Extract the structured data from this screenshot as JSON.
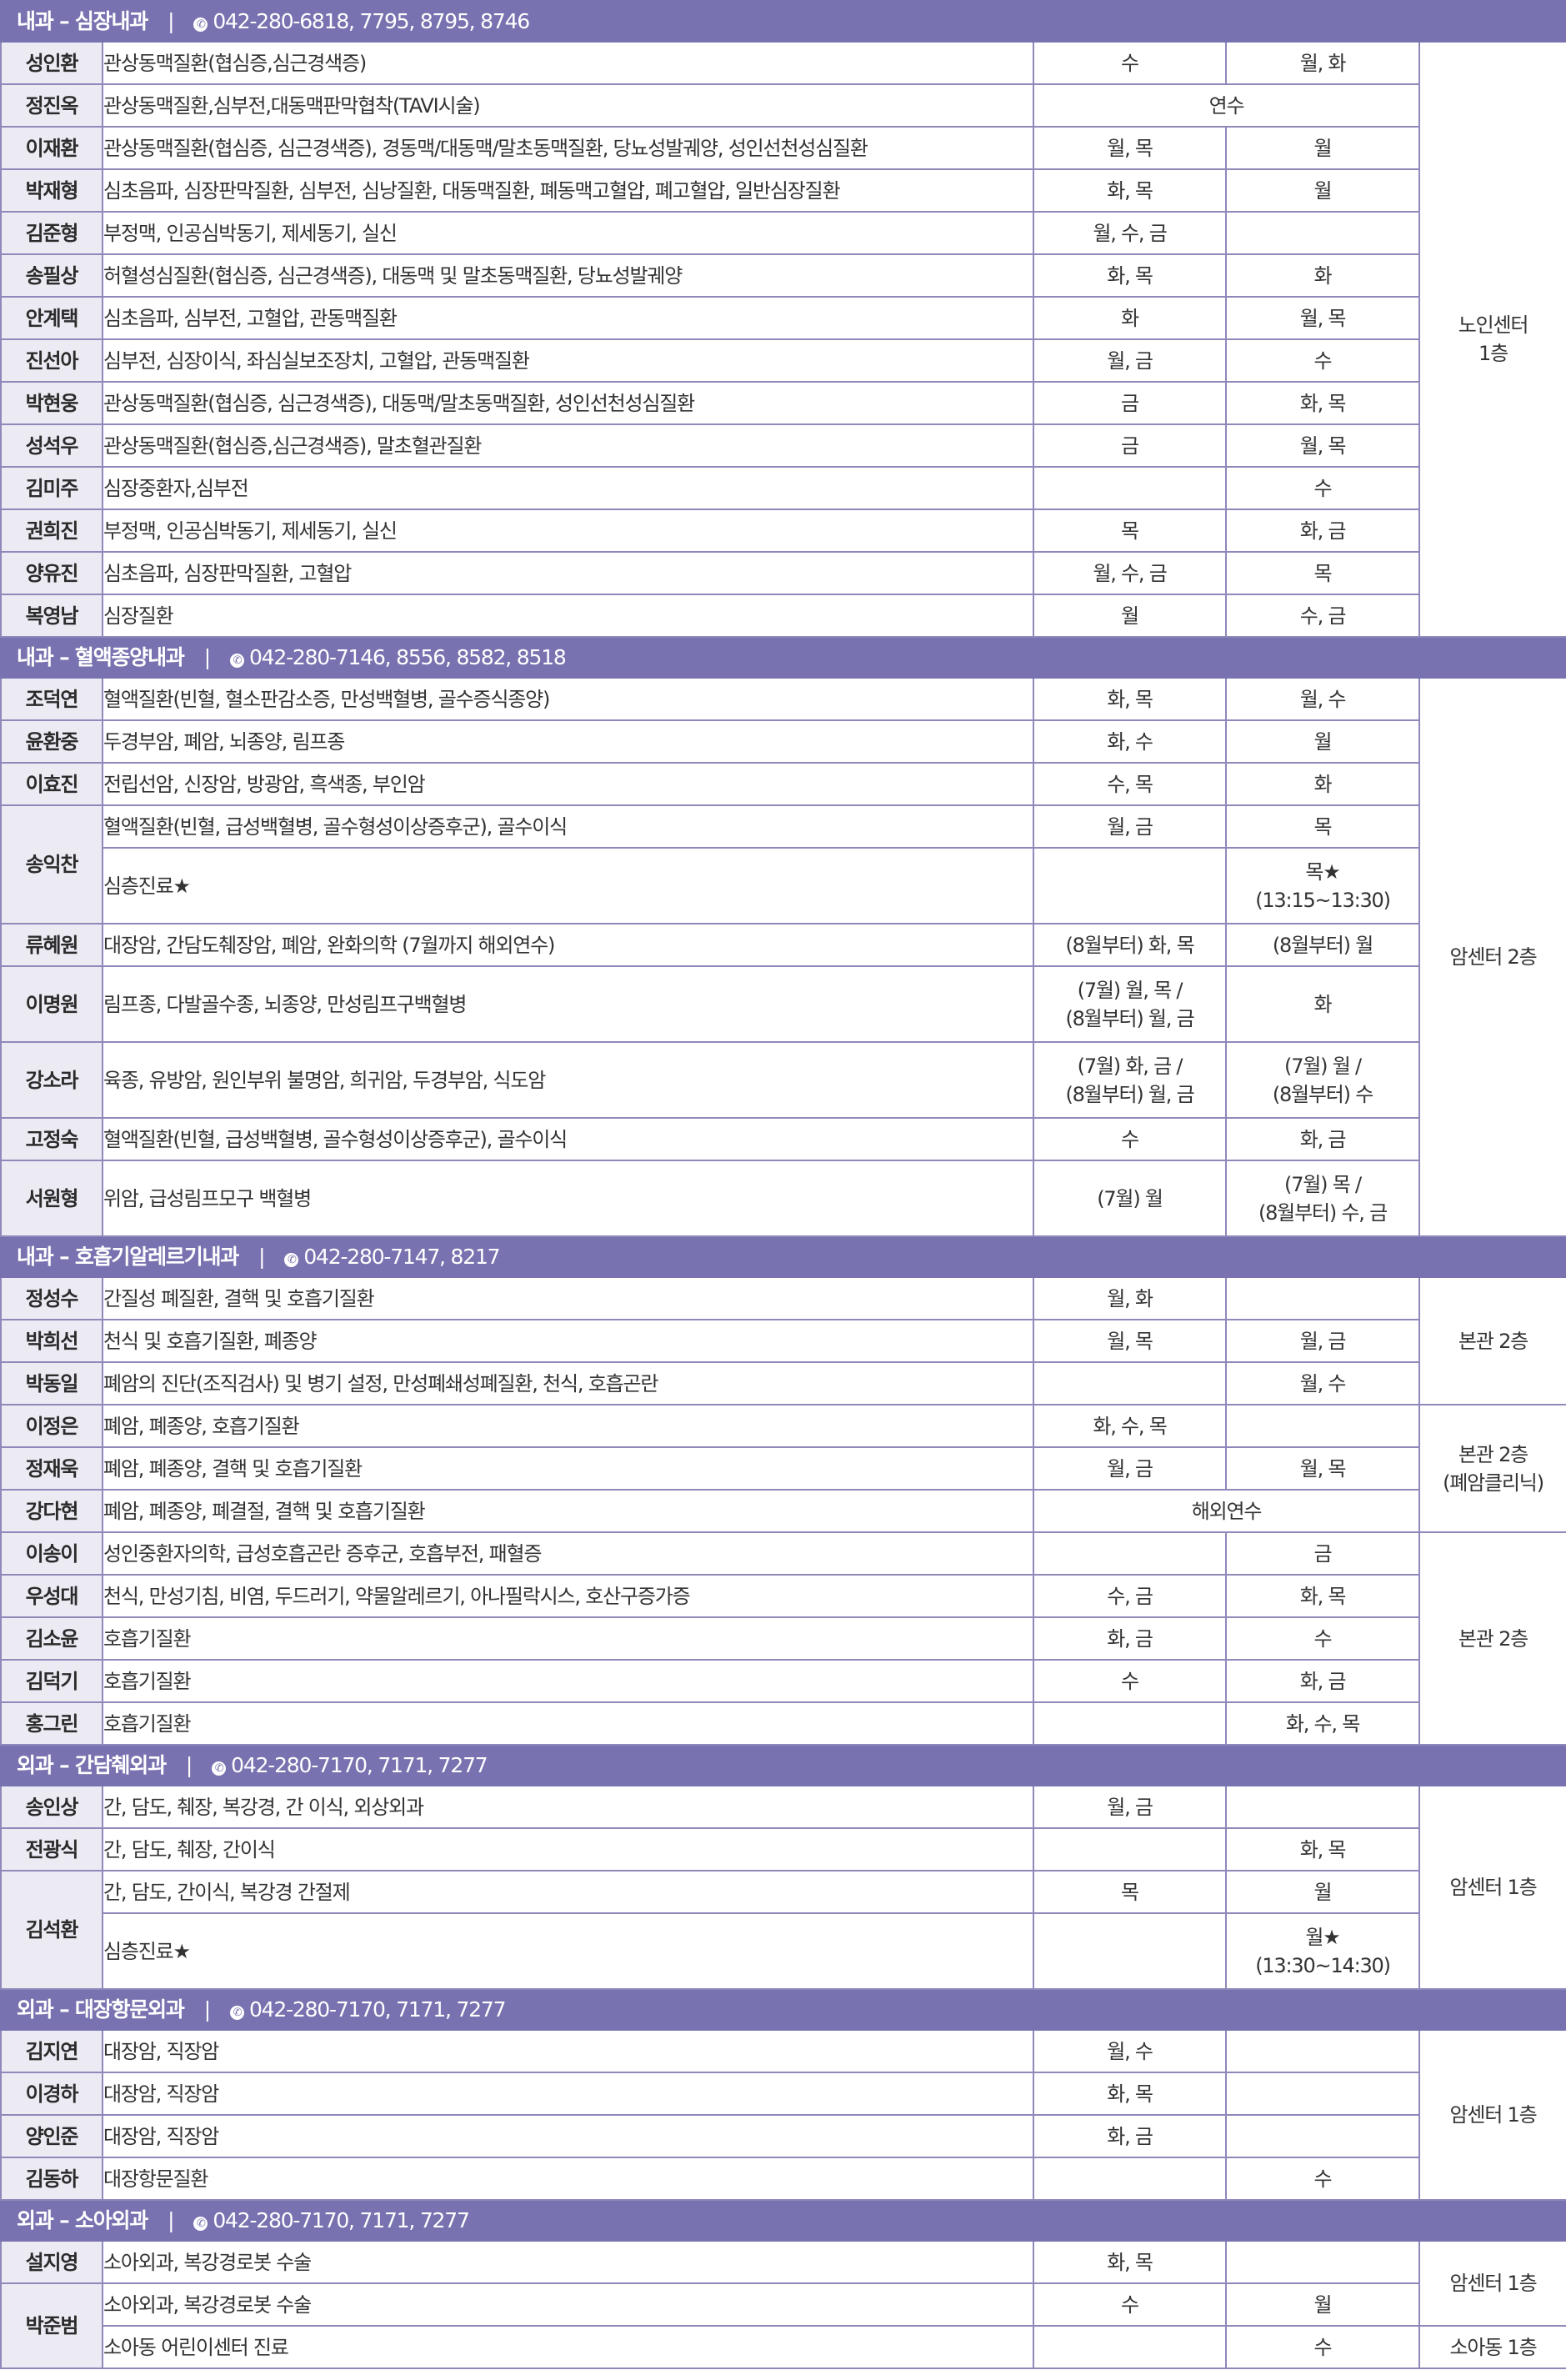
{
  "sections": [
    {
      "title": "내과 – 심장내과",
      "phone": "042-280-6818, 7795, 8795, 8746",
      "rows": [
        {
          "name": "성인환",
          "lines": [
            {
              "spec": "관상동맥질환(협심증,심근경색증)",
              "am": "수",
              "pm": "월, 화"
            }
          ]
        },
        {
          "name": "정진옥",
          "lines": [
            {
              "spec": "관상동맥질환,심부전,대동맥판막협착(TAVI시술)",
              "merged": "연수"
            }
          ]
        },
        {
          "name": "이재환",
          "lines": [
            {
              "spec": "관상동맥질환(협심증, 심근경색증), 경동맥/대동맥/말초동맥질환, 당뇨성발궤양, 성인선천성심질환",
              "am": "월, 목",
              "pm": "월"
            }
          ]
        },
        {
          "name": "박재형",
          "lines": [
            {
              "spec": "심초음파, 심장판막질환, 심부전, 심낭질환, 대동맥질환, 폐동맥고혈압, 폐고혈압, 일반심장질환",
              "am": "화, 목",
              "pm": "월"
            }
          ]
        },
        {
          "name": "김준형",
          "lines": [
            {
              "spec": "부정맥, 인공심박동기, 제세동기, 실신",
              "am": "월, 수, 금",
              "pm": ""
            }
          ]
        },
        {
          "name": "송필상",
          "lines": [
            {
              "spec": "허혈성심질환(협심증, 심근경색증), 대동맥 및 말초동맥질환, 당뇨성발궤양",
              "am": "화, 목",
              "pm": "화"
            }
          ]
        },
        {
          "name": "안계택",
          "lines": [
            {
              "spec": "심초음파, 심부전, 고혈압, 관동맥질환",
              "am": "화",
              "pm": "월, 목"
            }
          ]
        },
        {
          "name": "진선아",
          "lines": [
            {
              "spec": "심부전, 심장이식, 좌심실보조장치, 고혈압, 관동맥질환",
              "am": "월, 금",
              "pm": "수"
            }
          ]
        },
        {
          "name": "박현웅",
          "lines": [
            {
              "spec": "관상동맥질환(협심증, 심근경색증), 대동맥/말초동맥질환, 성인선천성심질환",
              "am": "금",
              "pm": "화, 목"
            }
          ]
        },
        {
          "name": "성석우",
          "lines": [
            {
              "spec": "관상동맥질환(협심증,심근경색증), 말초혈관질환",
              "am": "금",
              "pm": "월, 목"
            }
          ]
        },
        {
          "name": "김미주",
          "lines": [
            {
              "spec": "심장중환자,심부전",
              "am": "",
              "pm": "수"
            }
          ]
        },
        {
          "name": "권희진",
          "lines": [
            {
              "spec": "부정맥, 인공심박동기, 제세동기, 실신",
              "am": "목",
              "pm": "화, 금"
            }
          ]
        },
        {
          "name": "양유진",
          "lines": [
            {
              "spec": "심초음파, 심장판막질환, 고혈압",
              "am": "월, 수, 금",
              "pm": "목"
            }
          ]
        },
        {
          "name": "복영남",
          "lines": [
            {
              "spec": "심장질환",
              "am": "월",
              "pm": "수, 금"
            }
          ]
        }
      ],
      "locations": [
        {
          "label": "노인센터\n1층",
          "span": 14
        }
      ]
    },
    {
      "title": "내과 – 혈액종양내과",
      "phone": "042-280-7146, 8556, 8582, 8518",
      "rows": [
        {
          "name": "조덕연",
          "lines": [
            {
              "spec": "혈액질환(빈혈, 혈소판감소증, 만성백혈병, 골수증식종양)",
              "am": "화, 목",
              "pm": "월, 수"
            }
          ]
        },
        {
          "name": "윤환중",
          "lines": [
            {
              "spec": "두경부암, 폐암, 뇌종양, 림프종",
              "am": "화, 수",
              "pm": "월"
            }
          ]
        },
        {
          "name": "이효진",
          "lines": [
            {
              "spec": "전립선암, 신장암, 방광암, 흑색종, 부인암",
              "am": "수, 목",
              "pm": "화"
            }
          ]
        },
        {
          "name": "송익찬",
          "lines": [
            {
              "spec": "혈액질환(빈혈, 급성백혈병, 골수형성이상증후군), 골수이식",
              "am": "월, 금",
              "pm": "목"
            },
            {
              "spec": "심층진료★",
              "am": "",
              "pm": "목★\n(13:15~13:30)"
            }
          ]
        },
        {
          "name": "류혜원",
          "lines": [
            {
              "spec": "대장암, 간담도췌장암, 폐암, 완화의학 (7월까지 해외연수)",
              "am": "(8월부터) 화, 목",
              "pm": "(8월부터) 월"
            }
          ]
        },
        {
          "name": "이명원",
          "lines": [
            {
              "spec": "림프종, 다발골수종, 뇌종양, 만성림프구백혈병",
              "am": "(7월) 월, 목 /\n(8월부터) 월, 금",
              "pm": "화"
            }
          ]
        },
        {
          "name": "강소라",
          "lines": [
            {
              "spec": "육종, 유방암, 원인부위 불명암, 희귀암, 두경부암, 식도암",
              "am": "(7월) 화, 금 /\n(8월부터) 월, 금",
              "pm": "(7월) 월 /\n(8월부터) 수"
            }
          ]
        },
        {
          "name": "고정숙",
          "lines": [
            {
              "spec": "혈액질환(빈혈, 급성백혈병, 골수형성이상증후군), 골수이식",
              "am": "수",
              "pm": "화, 금"
            }
          ]
        },
        {
          "name": "서원형",
          "lines": [
            {
              "spec": "위암, 급성림프모구 백혈병",
              "am": "(7월) 월",
              "pm": "(7월) 목 /\n(8월부터) 수, 금"
            }
          ]
        }
      ],
      "locations": [
        {
          "label": "암센터 2층",
          "span": 10
        }
      ]
    },
    {
      "title": "내과 – 호흡기알레르기내과",
      "phone": "042-280-7147, 8217",
      "rows": [
        {
          "name": "정성수",
          "lines": [
            {
              "spec": "간질성 폐질환, 결핵 및 호흡기질환",
              "am": "월, 화",
              "pm": ""
            }
          ]
        },
        {
          "name": "박희선",
          "lines": [
            {
              "spec": "천식 및 호흡기질환, 폐종양",
              "am": "월, 목",
              "pm": "월, 금"
            }
          ]
        },
        {
          "name": "박동일",
          "lines": [
            {
              "spec": "폐암의 진단(조직검사) 및 병기 설정, 만성폐쇄성폐질환, 천식, 호흡곤란",
              "am": "",
              "pm": "월, 수"
            }
          ]
        },
        {
          "name": "이정은",
          "lines": [
            {
              "spec": "폐암, 폐종양, 호흡기질환",
              "am": "화, 수, 목",
              "pm": ""
            }
          ]
        },
        {
          "name": "정재욱",
          "lines": [
            {
              "spec": "폐암, 폐종양, 결핵 및 호흡기질환",
              "am": "월, 금",
              "pm": "월, 목"
            }
          ]
        },
        {
          "name": "강다현",
          "lines": [
            {
              "spec": "폐암, 폐종양, 폐결절, 결핵 및 호흡기질환",
              "merged": "해외연수"
            }
          ]
        },
        {
          "name": "이송이",
          "lines": [
            {
              "spec": "성인중환자의학, 급성호흡곤란 증후군, 호흡부전, 패혈증",
              "am": "",
              "pm": "금"
            }
          ]
        },
        {
          "name": "우성대",
          "lines": [
            {
              "spec": "천식, 만성기침, 비염, 두드러기, 약물알레르기, 아나필락시스, 호산구증가증",
              "am": "수, 금",
              "pm": "화, 목"
            }
          ]
        },
        {
          "name": "김소윤",
          "lines": [
            {
              "spec": "호흡기질환",
              "am": "화, 금",
              "pm": "수"
            }
          ]
        },
        {
          "name": "김덕기",
          "lines": [
            {
              "spec": "호흡기질환",
              "am": "수",
              "pm": "화, 금"
            }
          ]
        },
        {
          "name": "홍그린",
          "lines": [
            {
              "spec": "호흡기질환",
              "am": "",
              "pm": "화, 수, 목"
            }
          ]
        }
      ],
      "locations": [
        {
          "label": "본관 2층",
          "span": 3
        },
        {
          "label": "본관 2층\n(폐암클리닉)",
          "span": 3
        },
        {
          "label": "본관 2층",
          "span": 5
        }
      ]
    },
    {
      "title": "외과 – 간담췌외과",
      "phone": "042-280-7170, 7171, 7277",
      "rows": [
        {
          "name": "송인상",
          "lines": [
            {
              "spec": "간, 담도, 췌장, 복강경, 간 이식, 외상외과",
              "am": "월, 금",
              "pm": ""
            }
          ]
        },
        {
          "name": "전광식",
          "lines": [
            {
              "spec": "간, 담도, 췌장, 간이식",
              "am": "",
              "pm": "화, 목"
            }
          ]
        },
        {
          "name": "김석환",
          "lines": [
            {
              "spec": "간, 담도, 간이식, 복강경 간절제",
              "am": "목",
              "pm": "월"
            },
            {
              "spec": "심층진료★",
              "am": "",
              "pm": "월★\n(13:30~14:30)"
            }
          ]
        }
      ],
      "locations": [
        {
          "label": "암센터 1층",
          "span": 4
        }
      ]
    },
    {
      "title": "외과 – 대장항문외과",
      "phone": "042-280-7170, 7171, 7277",
      "rows": [
        {
          "name": "김지연",
          "lines": [
            {
              "spec": "대장암, 직장암",
              "am": "월, 수",
              "pm": ""
            }
          ]
        },
        {
          "name": "이경하",
          "lines": [
            {
              "spec": "대장암, 직장암",
              "am": "화, 목",
              "pm": ""
            }
          ]
        },
        {
          "name": "양인준",
          "lines": [
            {
              "spec": "대장암, 직장암",
              "am": "화, 금",
              "pm": ""
            }
          ]
        },
        {
          "name": "김동하",
          "lines": [
            {
              "spec": "대장항문질환",
              "am": "",
              "pm": "수"
            }
          ]
        }
      ],
      "locations": [
        {
          "label": "암센터 1층",
          "span": 4
        }
      ]
    },
    {
      "title": "외과 – 소아외과",
      "phone": "042-280-7170, 7171, 7277",
      "rows": [
        {
          "name": "설지영",
          "lines": [
            {
              "spec": "소아외과, 복강경로봇 수술",
              "am": "화, 목",
              "pm": ""
            }
          ]
        },
        {
          "name": "박준범",
          "lines": [
            {
              "spec": "소아외과, 복강경로봇 수술",
              "am": "수",
              "pm": "월"
            },
            {
              "spec": "소아동 어린이센터 진료",
              "am": "",
              "pm": "수"
            }
          ]
        }
      ],
      "locations": [
        {
          "label": "암센터 1층",
          "span": 2
        },
        {
          "label": "소아동 1층",
          "span": 1
        }
      ]
    }
  ]
}
